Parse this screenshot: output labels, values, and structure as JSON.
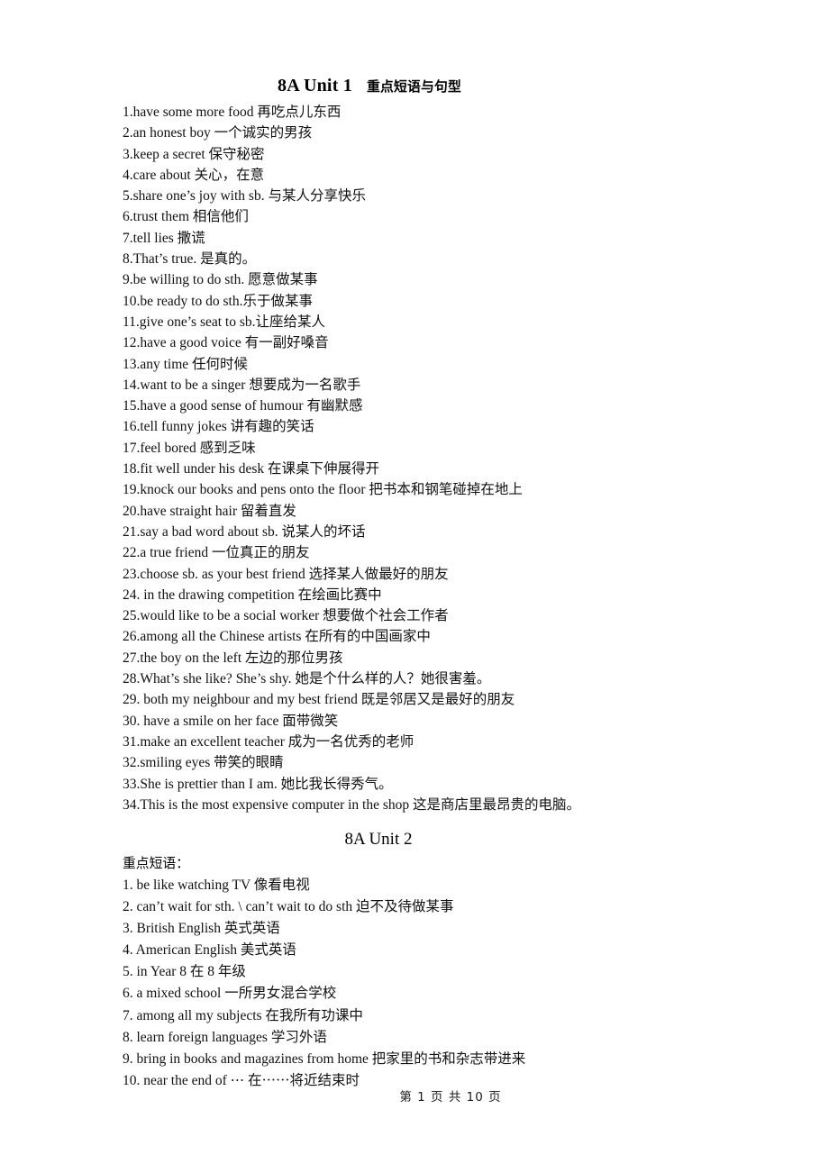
{
  "document": {
    "unit1": {
      "title_en": "8A Unit 1",
      "title_cn": "重点短语与句型",
      "items": [
        "1.have some more food  再吃点儿东西",
        "2.an honest boy    一个诚实的男孩",
        "3.keep a secret  保守秘密",
        "4.care about  关心，在意",
        "5.share one’s joy with sb.  与某人分享快乐",
        "6.trust them  相信他们",
        "7.tell lies  撒谎",
        "8.That’s true.  是真的。",
        "9.be willing to do sth.  愿意做某事",
        "10.be ready to do sth.乐于做某事",
        "11.give one’s seat to sb.让座给某人",
        "12.have a good voice  有一副好嗓音",
        "13.any time  任何时候",
        "14.want to be a singer  想要成为一名歌手",
        "15.have a good sense of humour  有幽默感",
        "16.tell funny jokes  讲有趣的笑话",
        "17.feel bored  感到乏味",
        "18.fit well under his desk  在课桌下伸展得开",
        "19.knock our books and pens onto the floor  把书本和钢笔碰掉在地上",
        "20.have straight hair  留着直发",
        "21.say a bad word about sb.  说某人的坏话",
        "22.a true friend  一位真正的朋友",
        "23.choose sb. as your best friend  选择某人做最好的朋友",
        "24. in the drawing competition  在绘画比赛中",
        "25.would like to be a social worker  想要做个社会工作者",
        "26.among all the Chinese artists  在所有的中国画家中",
        "27.the boy on the left  左边的那位男孩",
        "28.What’s she like? She’s shy.  她是个什么样的人？她很害羞。",
        "29. both my neighbour and my best friend  既是邻居又是最好的朋友",
        "30. have a smile on her face  面带微笑",
        "31.make an excellent teacher  成为一名优秀的老师",
        "32.smiling eyes  带笑的眼睛",
        "33.She is prettier than I am.  她比我长得秀气。",
        "34.This is the most expensive computer in the shop  这是商店里最昂贵的电脑。"
      ]
    },
    "unit2": {
      "title": "8A Unit 2",
      "section_label": "重点短语：",
      "items": [
        "1. be like watching TV    像看电视",
        "2. can’t wait for sth. \\ can’t wait to do sth    迫不及待做某事",
        "3. British English    英式英语",
        "4. American English    美式英语",
        "5. in Year 8    在 8 年级",
        "6. a mixed school    一所男女混合学校",
        "7. among all my subjects    在我所有功课中",
        "8. learn foreign languages    学习外语",
        "9. bring in books and magazines from home    把家里的书和杂志带进来",
        "10. near the end of ⋯    在⋯⋯将近结束时"
      ]
    },
    "footer": {
      "text": "第 1 页 共 10 页",
      "page_number": "1",
      "total_pages": "10"
    }
  }
}
